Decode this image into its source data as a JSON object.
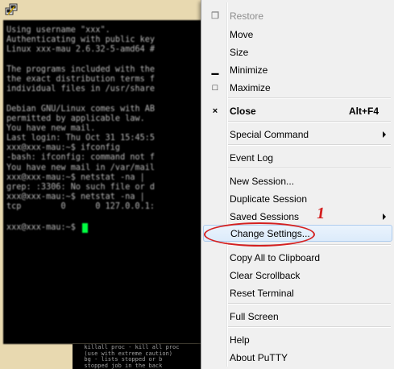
{
  "terminal": {
    "lines": [
      "Using username \"xxx\".",
      "Authenticating with public key",
      "Linux xxx-mau 2.6.32-5-amd64 #",
      "",
      "The programs included with the",
      "the exact distribution terms f",
      "individual files in /usr/share",
      "",
      "Debian GNU/Linux comes with AB",
      "permitted by applicable law.",
      "You have new mail.",
      "Last login: Thu Oct 31 15:45:5",
      "xxx@xxx-mau:~$ ifconfig",
      "-bash: ifconfig: command not f",
      "You have new mail in /var/mail",
      "xxx@xxx-mau:~$ netstat -na | ",
      "grep: :3306: No such file or d",
      "xxx@xxx-mau:~$ netstat -na | ",
      "tcp        0      0 127.0.0.1:",
      ""
    ],
    "prompt": "xxx@xxx-mau:~$",
    "cursor_color": "#00ff41",
    "bottom_lines": [
      "  killall proc - kill all proc",
      "  (use with extreme caution)",
      "  bg - lists stopped or b",
      "  stopped job in the back"
    ]
  },
  "menu": {
    "items": [
      {
        "label": "Restore",
        "icon": "restore-icon",
        "glyph": "❐",
        "disabled": true
      },
      {
        "label": "Move"
      },
      {
        "label": "Size"
      },
      {
        "label": "Minimize",
        "icon": "minimize-icon",
        "glyph": "▁"
      },
      {
        "label": "Maximize",
        "icon": "maximize-icon",
        "glyph": "□"
      },
      {
        "label": "Close",
        "shortcut": "Alt+F4",
        "icon": "close-icon",
        "glyph": "×",
        "bold": true
      },
      {
        "label": "Special Command",
        "submenu": true
      },
      {
        "label": "Event Log"
      },
      {
        "label": "New Session..."
      },
      {
        "label": "Duplicate Session"
      },
      {
        "label": "Saved Sessions",
        "submenu": true
      },
      {
        "label": "Change Settings...",
        "highlighted": true
      },
      {
        "label": "Copy All to Clipboard"
      },
      {
        "label": "Clear Scrollback"
      },
      {
        "label": "Reset Terminal"
      },
      {
        "label": "Full Screen"
      },
      {
        "label": "Help"
      },
      {
        "label": "About PuTTY"
      }
    ]
  },
  "annotation": {
    "number": "1",
    "color": "#d42020"
  }
}
